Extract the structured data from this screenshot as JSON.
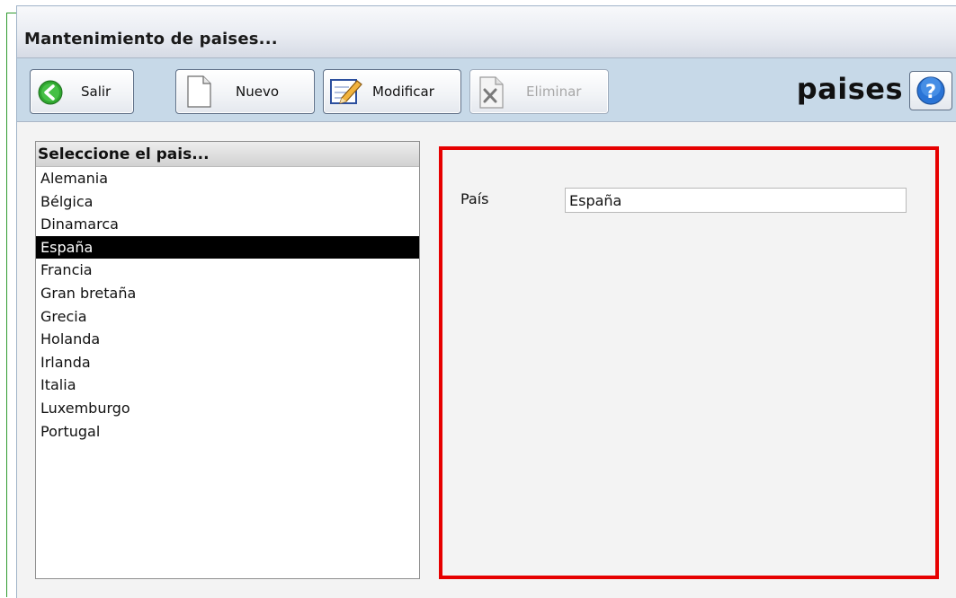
{
  "window": {
    "title": "Mantenimiento de paises..."
  },
  "toolbar": {
    "exit_label": "Salir",
    "new_label": "Nuevo",
    "modify_label": "Modificar",
    "delete_label": "Eliminar",
    "delete_disabled": true,
    "section_title": "paises"
  },
  "country_list": {
    "header": "Seleccione el pais...",
    "selected": "España",
    "items": [
      "Alemania",
      "Bélgica",
      "Dinamarca",
      "España",
      "Francia",
      "Gran bretaña",
      "Grecia",
      "Holanda",
      "Irlanda",
      "Italia",
      "Luxemburgo",
      "Portugal"
    ]
  },
  "detail": {
    "country_label": "País",
    "country_value": "España",
    "highlight_color": "#e60000"
  },
  "colors": {
    "toolbar_bg": "#c7d9e8",
    "selection_bg": "#000000",
    "selection_fg": "#ffffff",
    "exit_icon": "#2fa52f",
    "help_icon": "#2a74d6"
  },
  "icons": {
    "exit": "back-arrow-icon",
    "new": "blank-document-icon",
    "modify": "edit-pencil-icon",
    "delete": "delete-document-icon",
    "help": "help-question-icon"
  }
}
